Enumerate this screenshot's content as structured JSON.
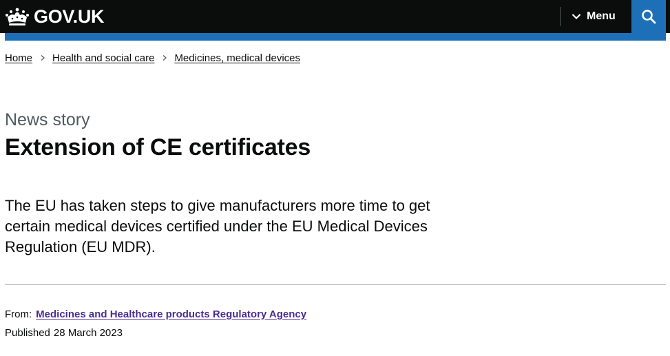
{
  "header": {
    "logo_text": "GOV.UK",
    "menu_label": "Menu",
    "colors": {
      "background": "#0b0c0c",
      "accent": "#1d70b8"
    }
  },
  "breadcrumbs": [
    {
      "label": "Home"
    },
    {
      "label": "Health and social care"
    },
    {
      "label": "Medicines, medical devices"
    }
  ],
  "page": {
    "caption": "News story",
    "title": "Extension of CE certificates",
    "lead": "The EU has taken steps to give manufacturers more time to get certain medical devices certified under the EU Medical Devices Regulation (EU MDR)."
  },
  "metadata": {
    "from_label": "From:",
    "from_org": "Medicines and Healthcare products Regulatory Agency",
    "published_label": "Published",
    "published_date": "28 March 2023",
    "link_color": "#4c2c92"
  },
  "icons": {
    "logo": "crown-icon",
    "menu": "chevron-down-icon",
    "search": "search-icon",
    "breadcrumb_separator": "chevron-right-icon"
  }
}
